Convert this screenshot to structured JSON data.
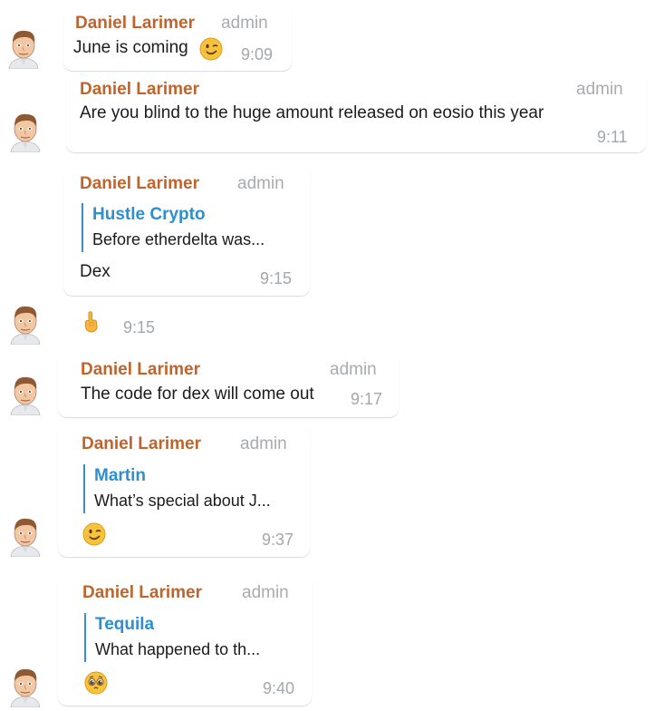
{
  "messages": [
    {
      "author": "Daniel Larimer",
      "role": "admin",
      "text": "June is coming",
      "emoji": "winking-face",
      "time": "9:09"
    },
    {
      "author": "Daniel Larimer",
      "role": "admin",
      "text": "Are you blind to the huge amount released on eosio this year",
      "time": "9:11"
    },
    {
      "author": "Daniel Larimer",
      "role": "admin",
      "reply": {
        "author": "Hustle Crypto",
        "text": "Before etherdelta was..."
      },
      "text": "Dex",
      "time": "9:15"
    },
    {
      "emoji": "pointing-up-hand",
      "time": "9:15"
    },
    {
      "author": "Daniel Larimer",
      "role": "admin",
      "text": "The code for dex will come out",
      "time": "9:17"
    },
    {
      "author": "Daniel Larimer",
      "role": "admin",
      "reply": {
        "author": "Martin",
        "text": "What’s special about J..."
      },
      "emoji": "winking-face",
      "time": "9:37"
    },
    {
      "author": "Daniel Larimer",
      "role": "admin",
      "reply": {
        "author": "Tequila",
        "text": "What happened to th..."
      },
      "emoji": "pleading-face",
      "time": "9:40"
    }
  ],
  "avatar_icon": "user-avatar-cartoon",
  "colors": {
    "author": "#c0642c",
    "quote_author": "#2d8ed0",
    "quote_bar": "#3b8ec9",
    "meta": "#a4a7ab",
    "text": "#1b1b1b",
    "bubble": "#ffffff"
  }
}
